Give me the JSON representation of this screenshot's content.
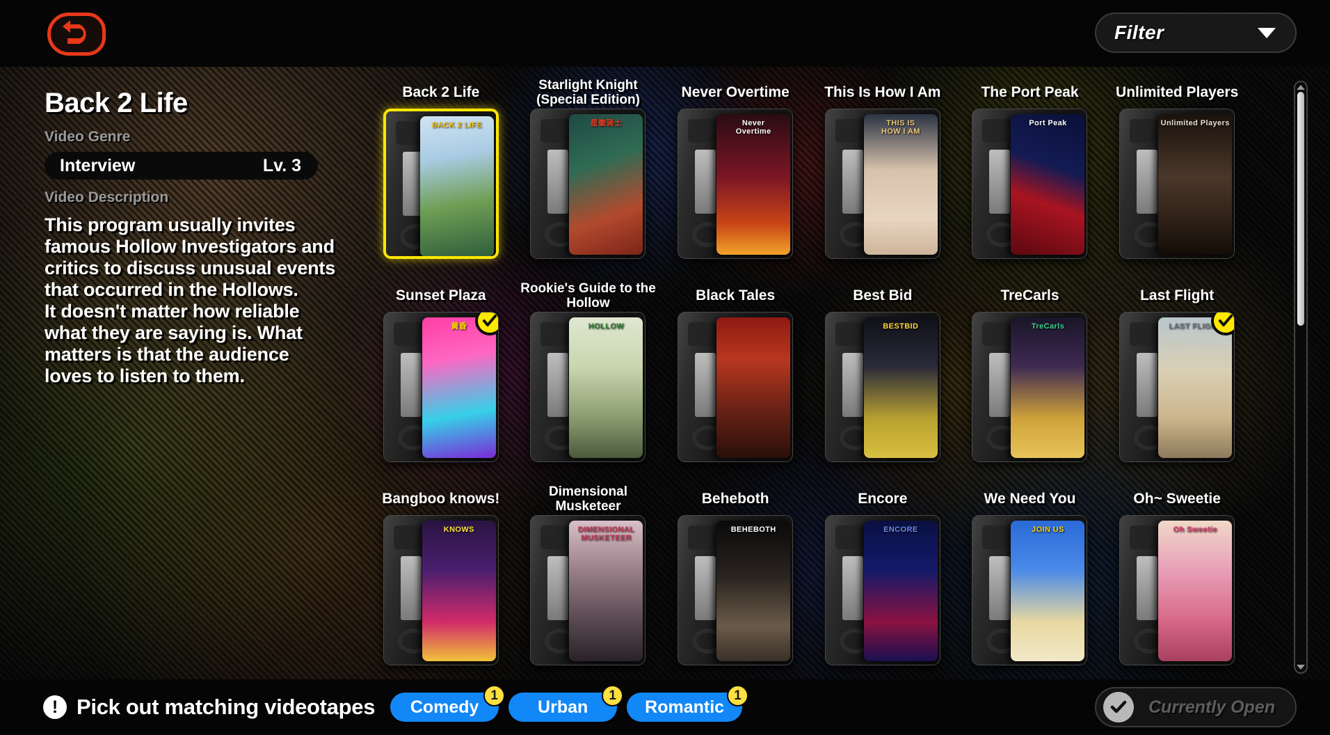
{
  "topbar": {
    "back_icon": "back-arrow-icon",
    "filter_label": "Filter",
    "filter_caret_icon": "chevron-down-icon"
  },
  "info": {
    "title": "Back 2 Life",
    "genre_section_label": "Video Genre",
    "genre_value": "Interview",
    "level": "Lv. 3",
    "description_section_label": "Video Description",
    "description": "This program usually invites famous Hollow Investigators and critics to discuss unusual events that occurred in the Hollows.\nIt doesn't matter how reliable what they are saying is. What matters is that the audience loves to listen to them."
  },
  "grid": {
    "cards": [
      {
        "title": "Back 2 Life",
        "selected": true,
        "checked": false,
        "cover_text": "BACK 2 LIFE",
        "art": "linear-gradient(170deg,#cfe3f2 0%,#a9cbe3 30%,#6f9f55 62%,#2f5d3c 100%)",
        "title_color": "#f5c518"
      },
      {
        "title": "Starlight Knight\n(Special Edition)",
        "selected": false,
        "checked": false,
        "cover_text": "星徽骑士",
        "art": "linear-gradient(160deg,#1f4a44 0%,#2f6b54 35%,#b24a2e 70%,#7c2418 100%)",
        "title_color": "#e33a22"
      },
      {
        "title": "Never Overtime",
        "selected": false,
        "checked": false,
        "cover_text": "Never\nOvertime",
        "art": "linear-gradient(180deg,#2a0c12 0%,#7c1626 45%,#c94516 78%,#f2a32a 100%)",
        "title_color": "#ffffff"
      },
      {
        "title": "This Is How I Am",
        "selected": false,
        "checked": false,
        "cover_text": "THIS IS\nHOW I AM",
        "art": "linear-gradient(180deg,#2b3344 0%,#d8c3ad 40%,#e8d5c0 75%,#cdb49a 100%)",
        "title_color": "#e8c87a"
      },
      {
        "title": "The Port Peak",
        "selected": false,
        "checked": false,
        "cover_text": "Port Peak",
        "art": "linear-gradient(200deg,#0a1038 0%,#141b54 38%,#a81420 62%,#5c0810 100%)",
        "title_color": "#ffffff"
      },
      {
        "title": "Unlimited Players",
        "selected": false,
        "checked": false,
        "cover_text": "Unlimited Players",
        "art": "linear-gradient(180deg,#1a120c 0%,#4a372a 45%,#2a1d14 80%,#120c08 100%)",
        "title_color": "#e6e0d4"
      },
      {
        "title": "Sunset Plaza",
        "selected": false,
        "checked": true,
        "cover_text": "黄昏",
        "art": "linear-gradient(170deg,#ff3fa4 0%,#ff66c2 30%,#36d0e8 68%,#7a2bd6 100%)",
        "title_color": "#ffe000"
      },
      {
        "title": "Rookie's Guide to the\nHollow",
        "selected": false,
        "checked": false,
        "cover_text": "HOLLOW",
        "art": "linear-gradient(180deg,#dfe7d2 0%,#c9d6ae 35%,#8d9e72 70%,#4c5a3c 100%)",
        "title_color": "#2a7d2a"
      },
      {
        "title": "Black Tales",
        "selected": false,
        "checked": false,
        "cover_text": "",
        "art": "linear-gradient(180deg,#8e1a12 0%,#b8371f 30%,#6a2216 65%,#2a0f0a 100%)",
        "title_color": "#ffffff"
      },
      {
        "title": "Best Bid",
        "selected": false,
        "checked": false,
        "cover_text": "BESTBID",
        "art": "linear-gradient(180deg,#101018 0%,#2a2a3a 35%,#b8a030 72%,#d8c040 100%)",
        "title_color": "#ffd83a"
      },
      {
        "title": "TreCarls",
        "selected": false,
        "checked": false,
        "cover_text": "TreCarls",
        "art": "linear-gradient(180deg,#1a1528 0%,#3e2a52 35%,#cfa23a 72%,#e8c45a 100%)",
        "title_color": "#3ecf8a"
      },
      {
        "title": "Last Flight",
        "selected": false,
        "checked": true,
        "cover_text": "LAST FLIGHT",
        "art": "linear-gradient(180deg,#b9c7cc 0%,#d9cfb4 38%,#cbb58c 72%,#8e7a5c 100%)",
        "title_color": "#6e7a82"
      },
      {
        "title": "Bangboo knows!",
        "selected": false,
        "checked": false,
        "cover_text": "KNOWS",
        "art": "linear-gradient(180deg,#2a1442 0%,#4a1f6e 35%,#d12a6a 72%,#f0c23a 100%)",
        "title_color": "#ffe53a"
      },
      {
        "title": "Dimensional\nMusketeer",
        "selected": false,
        "checked": false,
        "cover_text": "DIMENSIONAL\nMUSKETEER",
        "art": "linear-gradient(180deg,#d8c0c8 0%,#9a8088 35%,#5a4a52 70%,#2a2228 100%)",
        "title_color": "#c83a5a"
      },
      {
        "title": "Beheboth",
        "selected": false,
        "checked": false,
        "cover_text": "BEHEBOTH",
        "art": "linear-gradient(180deg,#0a0a0a 0%,#2a2420 40%,#6a5a48 75%,#3a3028 100%)",
        "title_color": "#ffffff"
      },
      {
        "title": "Encore",
        "selected": false,
        "checked": false,
        "cover_text": "ENCORE",
        "art": "linear-gradient(180deg,#0a1040 0%,#141a6a 35%,#8a1240 72%,#1a1050 100%)",
        "title_color": "#6a8ae8"
      },
      {
        "title": "We Need You",
        "selected": false,
        "checked": false,
        "cover_text": "JOIN US",
        "art": "linear-gradient(180deg,#2a6ad8 0%,#4a8ae8 35%,#e8d8a0 72%,#f0e8c8 100%)",
        "title_color": "#ffd400"
      },
      {
        "title": "Oh~ Sweetie",
        "selected": false,
        "checked": false,
        "cover_text": "Oh Sweetie",
        "art": "linear-gradient(180deg,#f0d8c8 0%,#e8a0b8 35%,#d86a8a 70%,#a84060 100%)",
        "title_color": "#e03a6a"
      }
    ]
  },
  "scrollbar": {
    "up_icon": "arrow-up-icon",
    "down_icon": "arrow-down-icon"
  },
  "bottombar": {
    "alert_icon": "exclamation-icon",
    "alert_glyph": "!",
    "prompt": "Pick out matching videotapes",
    "tags": [
      {
        "label": "Comedy",
        "count": "1"
      },
      {
        "label": "Urban",
        "count": "1"
      },
      {
        "label": "Romantic",
        "count": "1"
      }
    ],
    "open_button_label": "Currently\nOpen",
    "open_button_icon": "check-circle-icon"
  },
  "colors": {
    "accent_yellow": "#ffe800",
    "tag_blue": "#1287f7",
    "back_red": "#e8381a",
    "badge_yellow": "#ffe040"
  }
}
